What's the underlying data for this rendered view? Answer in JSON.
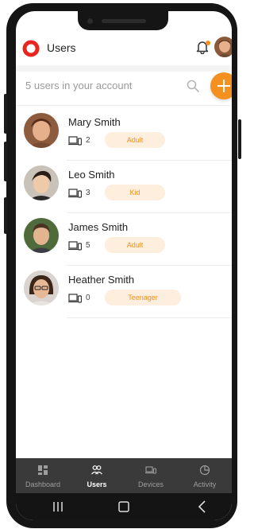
{
  "header": {
    "title": "Users",
    "logo_icon": "app-logo-ring-icon",
    "notification_icon": "bell-icon",
    "accent_color": "#f4901f"
  },
  "search": {
    "summary": "5 users in your account",
    "search_icon": "search-icon",
    "add_icon": "plus-icon"
  },
  "users": [
    {
      "name": "Mary Smith",
      "devices": "2",
      "role": "Adult"
    },
    {
      "name": "Leo Smith",
      "devices": "3",
      "role": "Kid"
    },
    {
      "name": "James Smith",
      "devices": "5",
      "role": "Adult"
    },
    {
      "name": "Heather Smith",
      "devices": "0",
      "role": "Teenager"
    }
  ],
  "bottom_nav": {
    "items": [
      {
        "label": "Dashboard",
        "icon": "dashboard-grid-icon",
        "active": false
      },
      {
        "label": "Users",
        "icon": "users-icon",
        "active": true
      },
      {
        "label": "Devices",
        "icon": "devices-icon",
        "active": false
      },
      {
        "label": "Activity",
        "icon": "activity-pie-icon",
        "active": false
      }
    ]
  },
  "system_nav": {
    "icons": [
      "recent-apps-icon",
      "home-icon",
      "back-icon"
    ]
  }
}
